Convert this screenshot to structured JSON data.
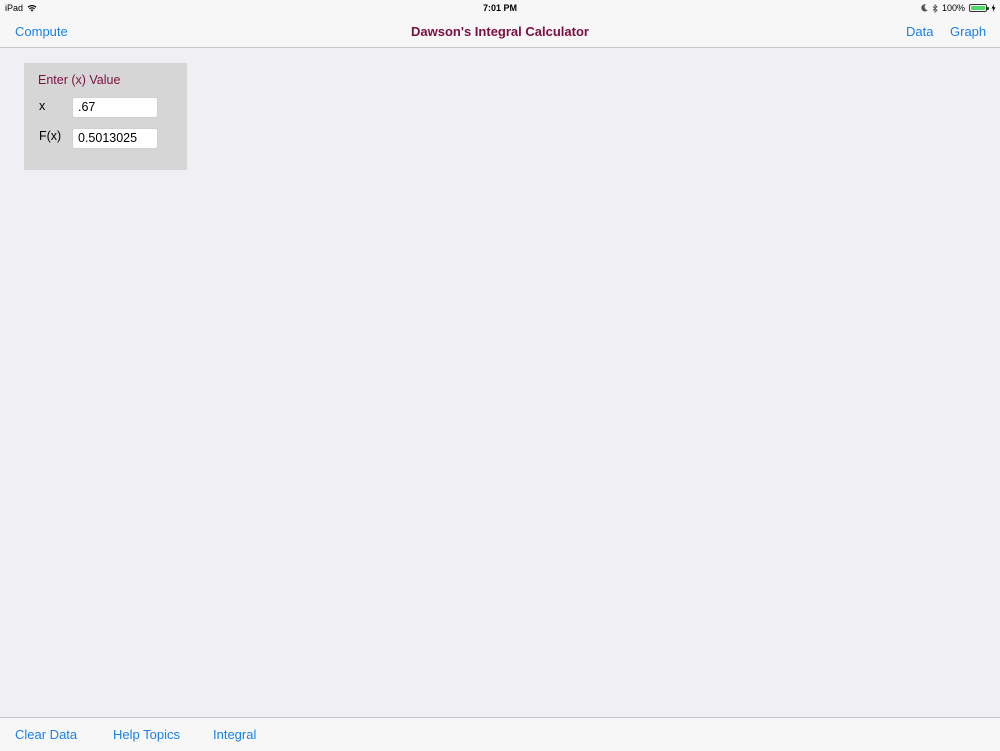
{
  "status_bar": {
    "device": "iPad",
    "time": "7:01 PM",
    "battery_percent": "100%",
    "battery_level": 1.0,
    "icons": [
      "wifi-icon",
      "moon-icon",
      "bluetooth-icon",
      "battery-icon",
      "charging-bolt-icon"
    ]
  },
  "nav": {
    "left_button": "Compute",
    "title": "Dawson's Integral Calculator",
    "right_buttons": [
      "Data",
      "Graph"
    ]
  },
  "panel": {
    "heading": "Enter (x) Value",
    "x_label": "x",
    "x_value": ".67",
    "fx_label": "F(x)",
    "fx_value": "0.5013025"
  },
  "toolbar": {
    "buttons": [
      "Clear Data",
      "Help Topics",
      "Integral"
    ]
  },
  "colors": {
    "accent": "#1a82e6",
    "title": "#7a1040",
    "background": "#efeff4",
    "panel": "#d6d6d6",
    "battery": "#4cd964"
  }
}
